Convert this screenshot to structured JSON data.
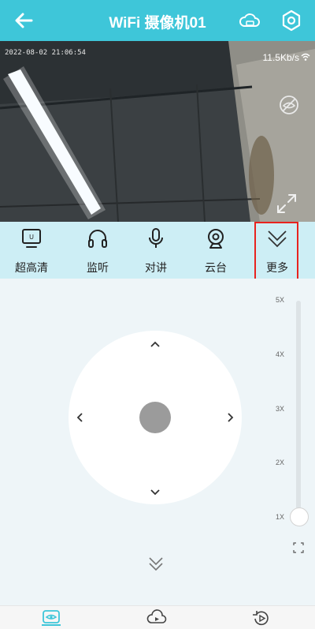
{
  "header": {
    "title": "WiFi 摄像机01",
    "back_icon": "arrow-left-icon",
    "cloud_icon": "cloud-icon",
    "settings_icon": "settings-hex-icon",
    "color": "#3ec6d9"
  },
  "video": {
    "timestamp": "2022-08-02 21:06:54",
    "speed": "11.5Kb/s",
    "wifi_icon": "wifi-icon",
    "hide_icon": "eye-off-icon",
    "expand_icon": "expand-icon"
  },
  "toolbar": {
    "items": [
      {
        "label": "超高清",
        "icon": "hd-screen-icon"
      },
      {
        "label": "监听",
        "icon": "headphones-icon"
      },
      {
        "label": "对讲",
        "icon": "microphone-icon"
      },
      {
        "label": "云台",
        "icon": "webcam-icon"
      },
      {
        "label": "更多",
        "icon": "chevron-down-icon",
        "highlight": "#e8231f"
      }
    ]
  },
  "ptz": {
    "zoom_levels": [
      "5X",
      "4X",
      "3X",
      "2X",
      "1X"
    ],
    "zoom_value": "1X"
  },
  "bottom_nav": {
    "items": [
      {
        "icon": "live-eye-icon",
        "active": true
      },
      {
        "icon": "cloud-playback-icon",
        "active": false
      },
      {
        "icon": "replay-icon",
        "active": false
      }
    ]
  }
}
